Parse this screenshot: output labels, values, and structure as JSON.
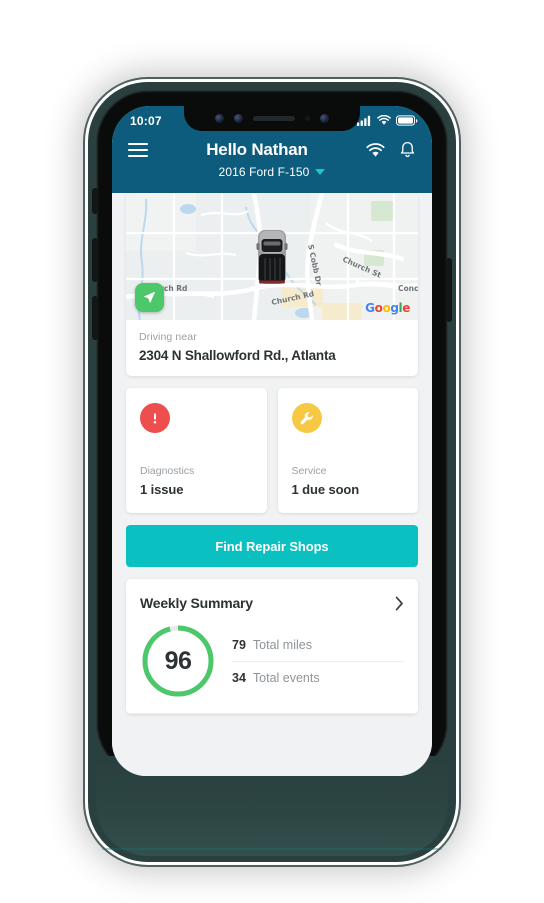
{
  "device": {
    "notch_icons": [
      "sensor-dot",
      "front-camera",
      "earpiece-speaker",
      "proximity-dot",
      "front-camera"
    ],
    "side_buttons": [
      "silent-switch",
      "volume-up",
      "volume-down",
      "power"
    ]
  },
  "status_bar": {
    "time": "10:07",
    "icons": [
      "cellular-signal-icon",
      "wifi-icon",
      "battery-icon"
    ]
  },
  "header": {
    "menu_icon": "hamburger-menu-icon",
    "title": "Hello Nathan",
    "vehicle": "2016 Ford F-150",
    "vehicle_caret": "chevron-down-icon",
    "actions": [
      "wifi-icon",
      "notification-bell-icon"
    ],
    "background_color": "#0d5b7d"
  },
  "map_card": {
    "provider_logo": "Google",
    "provider_letters": [
      "G",
      "o",
      "o",
      "g",
      "l",
      "e"
    ],
    "nav_button_icon": "navigation-arrow-icon",
    "vehicle_marker": "pickup-truck-top-view-icon",
    "street_labels": [
      "S Cobb Dr",
      "Church Rd",
      "Church Rd",
      "Church St",
      "Conc"
    ],
    "driving_label": "Driving near",
    "address": "2304 N Shallowford Rd., Atlanta"
  },
  "status_cards": [
    {
      "icon": "alert-exclamation-icon",
      "icon_color": "#ef4e4e",
      "title": "Diagnostics",
      "value": "1 issue"
    },
    {
      "icon": "wrench-icon",
      "icon_color": "#f7c844",
      "title": "Service",
      "value": "1 due soon"
    }
  ],
  "cta": {
    "label": "Find Repair Shops",
    "color": "#0ac0c0"
  },
  "weekly_summary": {
    "title": "Weekly Summary",
    "chevron": "chevron-right-icon",
    "score": "96",
    "score_percent": 96,
    "ring_color": "#4cc76a",
    "ring_track_color": "#e8eaec",
    "stats": [
      {
        "value": "79",
        "label": "Total miles"
      },
      {
        "value": "34",
        "label": "Total events"
      }
    ]
  }
}
